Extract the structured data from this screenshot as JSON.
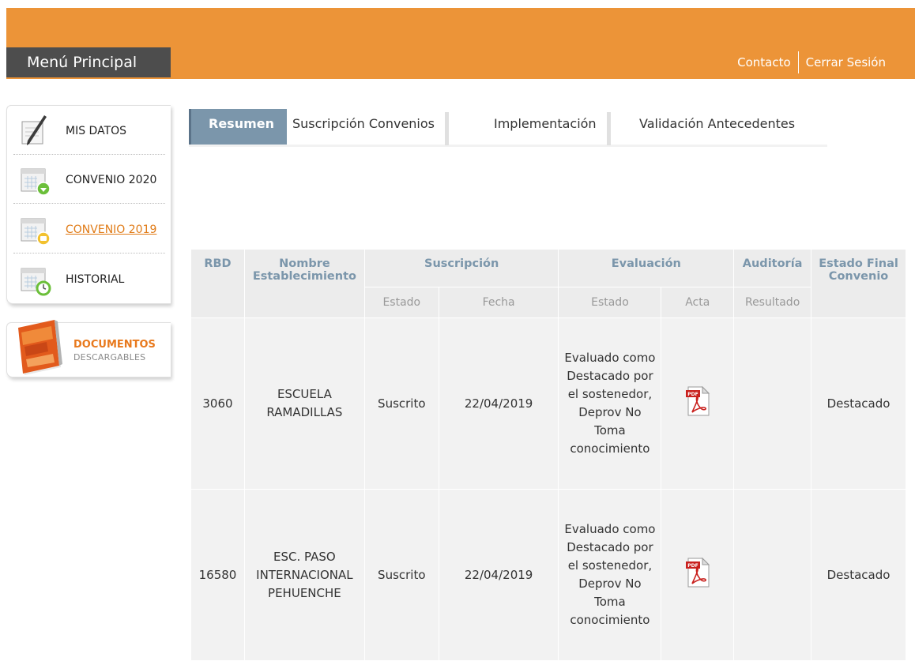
{
  "header": {
    "menu_title": "Menú Principal",
    "contact_link": "Contacto",
    "logout_link": "Cerrar Sesión",
    "bg_color": "#ec9438"
  },
  "sidebar": {
    "items": [
      {
        "label": "MIS DATOS",
        "icon": "pencil-note-icon"
      },
      {
        "label": "CONVENIO 2020",
        "icon": "calendar-green-icon"
      },
      {
        "label": "CONVENIO 2019",
        "icon": "calendar-yellow-icon"
      },
      {
        "label": "HISTORIAL",
        "icon": "calendar-clock-icon"
      }
    ],
    "docs_title": "DOCUMENTOS",
    "docs_subtitle": "DESCARGABLES"
  },
  "tabs": [
    {
      "label": "Resumen",
      "active": true
    },
    {
      "label": "Suscripción Convenios",
      "active": false
    },
    {
      "label": "Implementación",
      "active": false
    },
    {
      "label": "Validación Antecedentes",
      "active": false
    }
  ],
  "table": {
    "headers": {
      "rbd": "RBD",
      "nombre": "Nombre Establecimiento",
      "suscripcion": "Suscripción",
      "evaluacion": "Evaluación",
      "auditoria": "Auditoría",
      "estado_final": "Estado Final Convenio"
    },
    "subheaders": {
      "estado1": "Estado",
      "fecha": "Fecha",
      "estado2": "Estado",
      "acta": "Acta",
      "resultado": "Resultado"
    },
    "rows": [
      {
        "rbd": "3060",
        "nombre": "ESCUELA RAMADILLAS",
        "susc_estado": "Suscrito",
        "susc_fecha": "22/04/2019",
        "eval_estado": "Evaluado como Destacado por el sostenedor, Deprov No Toma conocimiento",
        "acta": "pdf-icon",
        "auditoria": "",
        "estado_final": "Destacado"
      },
      {
        "rbd": "16580",
        "nombre": "ESC. PASO INTERNACIONAL PEHUENCHE",
        "susc_estado": "Suscrito",
        "susc_fecha": "22/04/2019",
        "eval_estado": "Evaluado como Destacado por el sostenedor, Deprov No Toma conocimiento",
        "acta": "pdf-icon",
        "auditoria": "",
        "estado_final": "Destacado"
      }
    ]
  }
}
